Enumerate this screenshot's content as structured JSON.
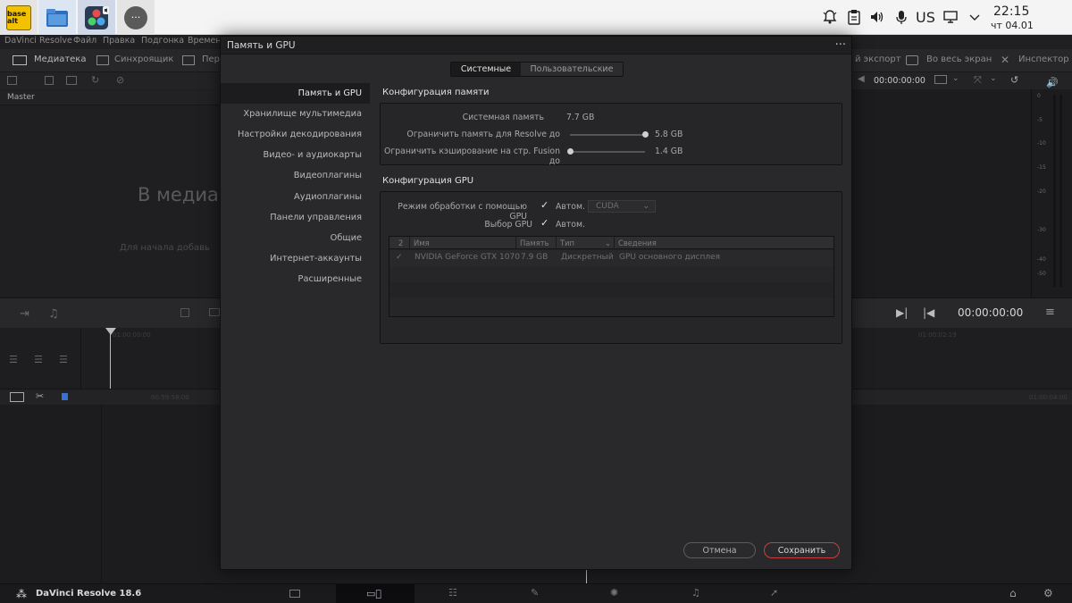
{
  "taskbar": {
    "apps": [
      {
        "name": "basealt-icon",
        "label": "base alt"
      },
      {
        "name": "files-icon",
        "label": ""
      },
      {
        "name": "davinci-resolve-icon",
        "label": ""
      },
      {
        "name": "more-apps-icon",
        "label": "···"
      }
    ],
    "keyboard_layout": "US",
    "time": "22:15",
    "date": "чт 04.01"
  },
  "app": {
    "menu": [
      "DaVinci Resolve",
      "Файл",
      "Правка",
      "Подгонка",
      "Времен"
    ],
    "toolbar": {
      "media": "Медиатека",
      "sync": "Синхроящик",
      "per": "Пер",
      "export": "й экспорт",
      "fullscreen": "Во весь экран",
      "inspector": "Инспектор"
    },
    "subtoolbar": {
      "timecode": "00:00:00:00"
    },
    "media_panel": {
      "bin": "Master",
      "empty_title": "В медиа",
      "empty_hint": "Для начала добавь"
    },
    "meter_ticks": [
      "0",
      "-5",
      "-10",
      "-15",
      "-20",
      "-30",
      "-40",
      "-50"
    ],
    "timeline": {
      "timecode": "00:00:00:00",
      "ruler_a": "01:00:00:00",
      "ruler_b": "01:00:02:19",
      "ruler_c": "00:59:58:00",
      "ruler_d": "01:00:04:00"
    },
    "status": {
      "product": "DaVinci Resolve 18.6"
    }
  },
  "modal": {
    "title": "Память и GPU",
    "tabs": [
      {
        "label": "Системные",
        "active": true
      },
      {
        "label": "Пользовательские",
        "active": false
      }
    ],
    "categories": [
      {
        "label": "Память и GPU",
        "active": true
      },
      {
        "label": "Хранилище мультимедиа",
        "active": false
      },
      {
        "label": "Настройки декодирования",
        "active": false
      },
      {
        "label": "Видео- и аудиокарты",
        "active": false
      },
      {
        "label": "Видеоплагины",
        "active": false
      },
      {
        "label": "Аудиоплагины",
        "active": false
      },
      {
        "label": "Панели управления",
        "active": false
      },
      {
        "label": "Общие",
        "active": false
      },
      {
        "label": "Интернет-аккаунты",
        "active": false
      },
      {
        "label": "Расширенные",
        "active": false
      }
    ],
    "memory": {
      "section_title": "Конфигурация памяти",
      "system_memory_label": "Системная память",
      "system_memory_value": "7.7 GB",
      "resolve_limit_label": "Ограничить память для Resolve до",
      "resolve_limit_value": "5.8 GB",
      "resolve_limit_fraction": 1.0,
      "fusion_limit_label": "Ограничить кэширование на стр. Fusion до",
      "fusion_limit_value": "1.4 GB",
      "fusion_limit_fraction": 0.0
    },
    "gpu": {
      "section_title": "Конфигурация GPU",
      "mode_label": "Режим обработки с помощью GPU",
      "mode_auto": "Автом.",
      "mode_auto_checked": true,
      "mode_select": "CUDA",
      "select_label": "Выбор GPU",
      "select_auto": "Автом.",
      "select_auto_checked": true,
      "table": {
        "headers": [
          "2",
          "Имя",
          "Память",
          "Тип",
          "Сведения"
        ],
        "rows": [
          {
            "checked": true,
            "name": "NVIDIA GeForce GTX 1070",
            "memory": "7.9 GB",
            "type": "Дискретный",
            "info": "GPU основного дисплея"
          }
        ]
      }
    },
    "buttons": {
      "cancel": "Отмена",
      "save": "Сохранить"
    },
    "accent": "#c63f3f"
  }
}
